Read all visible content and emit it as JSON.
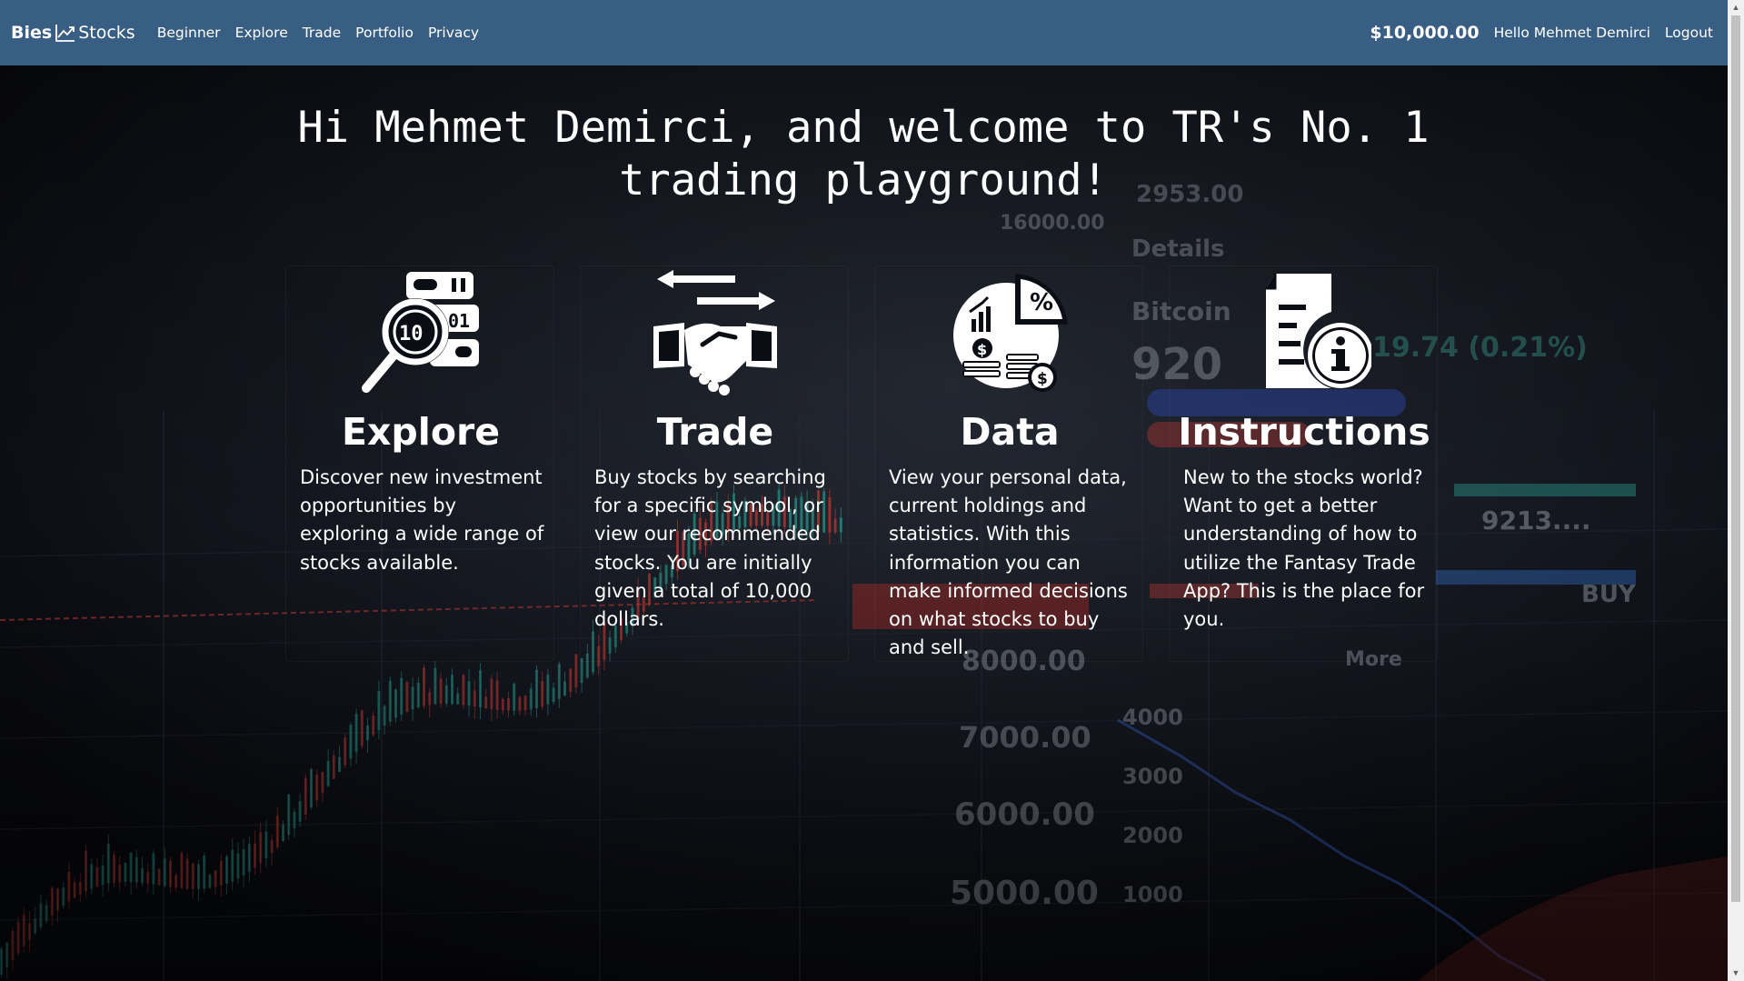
{
  "nav": {
    "brand_first": "Bies",
    "brand_second": "Stocks",
    "links": [
      "Beginner",
      "Explore",
      "Trade",
      "Portfolio",
      "Privacy"
    ],
    "balance": "$10,000.00",
    "user_greeting": "Hello Mehmet Demirci",
    "logout": "Logout"
  },
  "hero": {
    "line1": "Hi Mehmet Demirci, and welcome to TR's No. 1",
    "line2": "trading playground!"
  },
  "cards": [
    {
      "title": "Explore",
      "text": "Discover new investment opportunities by exploring a wide range of stocks available.",
      "icon": "database-search-icon"
    },
    {
      "title": "Trade",
      "text": "Buy stocks by searching for a specific symbol, or view our recommended stocks. You are initially given a total of 10,000 dollars.",
      "icon": "handshake-exchange-icon"
    },
    {
      "title": "Data",
      "text": "View your personal data, current holdings and statistics. With this information you can make informed decisions on what stocks to buy and sell.",
      "icon": "pie-chart-coins-icon"
    },
    {
      "title": "Instructions",
      "text": "New to the stocks world? Want to get a better understanding of how to utilize the Fantasy Trade App? This is the place for you.",
      "icon": "document-info-icon"
    }
  ],
  "colors": {
    "navbar": "#395e84",
    "background": "#0b0d14",
    "candle_up": "#2a8f86",
    "candle_down": "#b23a36",
    "text": "#ffffff"
  }
}
